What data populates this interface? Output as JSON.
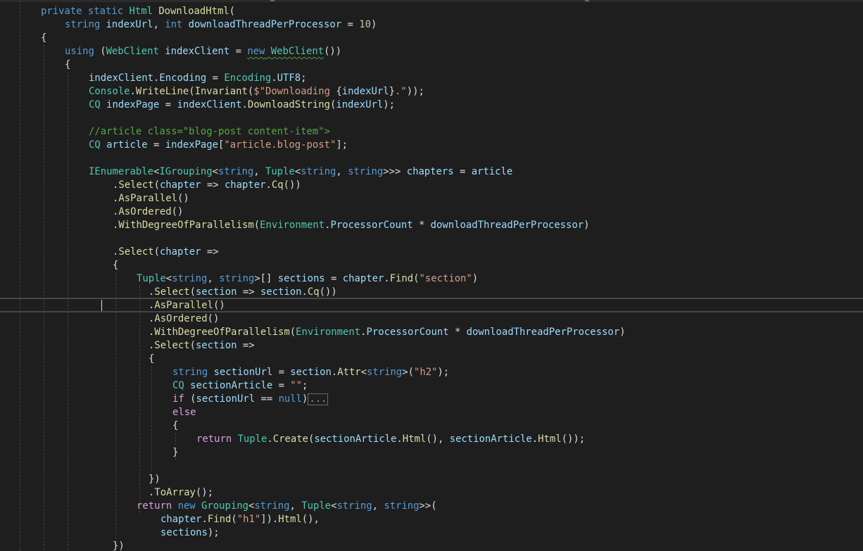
{
  "editor": {
    "language": "C#",
    "theme": "dark",
    "colors": {
      "background": "#1e1e1e",
      "keyword": "#569cd6",
      "control_keyword": "#d8a0df",
      "type": "#4ec9b0",
      "identifier": "#9cdcfe",
      "method": "#dcdcaa",
      "string": "#d69d85",
      "number": "#b5cea8",
      "comment": "#57a64a",
      "plain": "#dcdcdc"
    },
    "folded_region_label": "...",
    "caret_line": 22,
    "lines": [
      [
        [
          "kw",
          "private"
        ],
        [
          "pl",
          " "
        ],
        [
          "kw",
          "static"
        ],
        [
          "pl",
          " "
        ],
        [
          "type",
          "Html"
        ],
        [
          "pl",
          " "
        ],
        [
          "method",
          "DownloadHtml"
        ],
        [
          "pl",
          "("
        ]
      ],
      [
        [
          "kw",
          "string"
        ],
        [
          "pl",
          " "
        ],
        [
          "var",
          "indexUrl"
        ],
        [
          "pl",
          ", "
        ],
        [
          "kw",
          "int"
        ],
        [
          "pl",
          " "
        ],
        [
          "var",
          "downloadThreadPerProcessor"
        ],
        [
          "pl",
          " = "
        ],
        [
          "num",
          "10"
        ],
        [
          "pl",
          ")"
        ]
      ],
      [
        [
          "pl",
          "{"
        ]
      ],
      [
        [
          "kw",
          "using"
        ],
        [
          "pl",
          " ("
        ],
        [
          "type",
          "WebClient"
        ],
        [
          "pl",
          " "
        ],
        [
          "var",
          "indexClient"
        ],
        [
          "pl",
          " = "
        ],
        [
          "kw",
          "new"
        ],
        [
          "pl",
          " "
        ],
        [
          "type",
          "WebClient"
        ],
        [
          "pl",
          "())"
        ]
      ],
      [
        [
          "pl",
          "{"
        ]
      ],
      [
        [
          "var",
          "indexClient"
        ],
        [
          "pl",
          "."
        ],
        [
          "var",
          "Encoding"
        ],
        [
          "pl",
          " = "
        ],
        [
          "type",
          "Encoding"
        ],
        [
          "pl",
          "."
        ],
        [
          "var",
          "UTF8"
        ],
        [
          "pl",
          ";"
        ]
      ],
      [
        [
          "type",
          "Console"
        ],
        [
          "pl",
          "."
        ],
        [
          "method",
          "WriteLine"
        ],
        [
          "pl",
          "("
        ],
        [
          "method",
          "Invariant"
        ],
        [
          "pl",
          "("
        ],
        [
          "str",
          "$\"Downloading "
        ],
        [
          "pl",
          "{"
        ],
        [
          "var",
          "indexUrl"
        ],
        [
          "pl",
          "}"
        ],
        [
          "str",
          ".\""
        ],
        [
          "pl",
          "));"
        ]
      ],
      [
        [
          "type",
          "CQ"
        ],
        [
          "pl",
          " "
        ],
        [
          "var",
          "indexPage"
        ],
        [
          "pl",
          " = "
        ],
        [
          "var",
          "indexClient"
        ],
        [
          "pl",
          "."
        ],
        [
          "method",
          "DownloadString"
        ],
        [
          "pl",
          "("
        ],
        [
          "var",
          "indexUrl"
        ],
        [
          "pl",
          ");"
        ]
      ],
      [],
      [
        [
          "com",
          "//article class=\"blog-post content-item\">"
        ]
      ],
      [
        [
          "type",
          "CQ"
        ],
        [
          "pl",
          " "
        ],
        [
          "var",
          "article"
        ],
        [
          "pl",
          " = "
        ],
        [
          "var",
          "indexPage"
        ],
        [
          "pl",
          "["
        ],
        [
          "str",
          "\"article.blog-post\""
        ],
        [
          "pl",
          "];"
        ]
      ],
      [],
      [
        [
          "type",
          "IEnumerable"
        ],
        [
          "pl",
          "<"
        ],
        [
          "type",
          "IGrouping"
        ],
        [
          "pl",
          "<"
        ],
        [
          "kw",
          "string"
        ],
        [
          "pl",
          ", "
        ],
        [
          "type",
          "Tuple"
        ],
        [
          "pl",
          "<"
        ],
        [
          "kw",
          "string"
        ],
        [
          "pl",
          ", "
        ],
        [
          "kw",
          "string"
        ],
        [
          "pl",
          ">>> "
        ],
        [
          "var",
          "chapters"
        ],
        [
          "pl",
          " = "
        ],
        [
          "var",
          "article"
        ]
      ],
      [
        [
          "pl",
          "."
        ],
        [
          "method",
          "Select"
        ],
        [
          "pl",
          "("
        ],
        [
          "var",
          "chapter"
        ],
        [
          "pl",
          " => "
        ],
        [
          "var",
          "chapter"
        ],
        [
          "pl",
          "."
        ],
        [
          "method",
          "Cq"
        ],
        [
          "pl",
          "())"
        ]
      ],
      [
        [
          "pl",
          "."
        ],
        [
          "method",
          "AsParallel"
        ],
        [
          "pl",
          "()"
        ]
      ],
      [
        [
          "pl",
          "."
        ],
        [
          "method",
          "AsOrdered"
        ],
        [
          "pl",
          "()"
        ]
      ],
      [
        [
          "pl",
          "."
        ],
        [
          "method",
          "WithDegreeOfParallelism"
        ],
        [
          "pl",
          "("
        ],
        [
          "type",
          "Environment"
        ],
        [
          "pl",
          "."
        ],
        [
          "var",
          "ProcessorCount"
        ],
        [
          "pl",
          " * "
        ],
        [
          "var",
          "downloadThreadPerProcessor"
        ],
        [
          "pl",
          ")"
        ]
      ],
      [],
      [
        [
          "pl",
          "."
        ],
        [
          "method",
          "Select"
        ],
        [
          "pl",
          "("
        ],
        [
          "var",
          "chapter"
        ],
        [
          "pl",
          " =>"
        ]
      ],
      [
        [
          "pl",
          "{"
        ]
      ],
      [
        [
          "type",
          "Tuple"
        ],
        [
          "pl",
          "<"
        ],
        [
          "kw",
          "string"
        ],
        [
          "pl",
          ", "
        ],
        [
          "kw",
          "string"
        ],
        [
          "pl",
          ">[] "
        ],
        [
          "var",
          "sections"
        ],
        [
          "pl",
          " = "
        ],
        [
          "var",
          "chapter"
        ],
        [
          "pl",
          "."
        ],
        [
          "method",
          "Find"
        ],
        [
          "pl",
          "("
        ],
        [
          "str",
          "\"section\""
        ],
        [
          "pl",
          ")"
        ]
      ],
      [
        [
          "pl",
          "."
        ],
        [
          "method",
          "Select"
        ],
        [
          "pl",
          "("
        ],
        [
          "var",
          "section"
        ],
        [
          "pl",
          " => "
        ],
        [
          "var",
          "section"
        ],
        [
          "pl",
          "."
        ],
        [
          "method",
          "Cq"
        ],
        [
          "pl",
          "())"
        ]
      ],
      [
        [
          "pl",
          "."
        ],
        [
          "method",
          "AsParallel"
        ],
        [
          "pl",
          "()"
        ]
      ],
      [
        [
          "pl",
          "."
        ],
        [
          "method",
          "AsOrdered"
        ],
        [
          "pl",
          "()"
        ]
      ],
      [
        [
          "pl",
          "."
        ],
        [
          "method",
          "WithDegreeOfParallelism"
        ],
        [
          "pl",
          "("
        ],
        [
          "type",
          "Environment"
        ],
        [
          "pl",
          "."
        ],
        [
          "var",
          "ProcessorCount"
        ],
        [
          "pl",
          " * "
        ],
        [
          "var",
          "downloadThreadPerProcessor"
        ],
        [
          "pl",
          ")"
        ]
      ],
      [
        [
          "pl",
          "."
        ],
        [
          "method",
          "Select"
        ],
        [
          "pl",
          "("
        ],
        [
          "var",
          "section"
        ],
        [
          "pl",
          " =>"
        ]
      ],
      [
        [
          "pl",
          "{"
        ]
      ],
      [
        [
          "kw",
          "string"
        ],
        [
          "pl",
          " "
        ],
        [
          "var",
          "sectionUrl"
        ],
        [
          "pl",
          " = "
        ],
        [
          "var",
          "section"
        ],
        [
          "pl",
          "."
        ],
        [
          "method",
          "Attr"
        ],
        [
          "pl",
          "<"
        ],
        [
          "kw",
          "string"
        ],
        [
          "pl",
          ">("
        ],
        [
          "str",
          "\"h2\""
        ],
        [
          "pl",
          ");"
        ]
      ],
      [
        [
          "type",
          "CQ"
        ],
        [
          "pl",
          " "
        ],
        [
          "var",
          "sectionArticle"
        ],
        [
          "pl",
          " = "
        ],
        [
          "str",
          "\"\""
        ],
        [
          "pl",
          ";"
        ]
      ],
      [
        [
          "ctl",
          "if"
        ],
        [
          "pl",
          " ("
        ],
        [
          "var",
          "sectionUrl"
        ],
        [
          "pl",
          " == "
        ],
        [
          "kw",
          "null"
        ],
        [
          "pl",
          ")"
        ],
        [
          "fold",
          "..."
        ]
      ],
      [
        [
          "ctl",
          "else"
        ]
      ],
      [
        [
          "pl",
          "{"
        ]
      ],
      [
        [
          "ctl",
          "return"
        ],
        [
          "pl",
          " "
        ],
        [
          "type",
          "Tuple"
        ],
        [
          "pl",
          "."
        ],
        [
          "method",
          "Create"
        ],
        [
          "pl",
          "("
        ],
        [
          "var",
          "sectionArticle"
        ],
        [
          "pl",
          "."
        ],
        [
          "method",
          "Html"
        ],
        [
          "pl",
          "(), "
        ],
        [
          "var",
          "sectionArticle"
        ],
        [
          "pl",
          "."
        ],
        [
          "method",
          "Html"
        ],
        [
          "pl",
          "());"
        ]
      ],
      [
        [
          "pl",
          "}"
        ]
      ],
      [],
      [
        [
          "pl",
          "})"
        ]
      ],
      [
        [
          "pl",
          "."
        ],
        [
          "method",
          "ToArray"
        ],
        [
          "pl",
          "();"
        ]
      ],
      [
        [
          "ctl",
          "return"
        ],
        [
          "pl",
          " "
        ],
        [
          "kw",
          "new"
        ],
        [
          "pl",
          " "
        ],
        [
          "type",
          "Grouping"
        ],
        [
          "pl",
          "<"
        ],
        [
          "kw",
          "string"
        ],
        [
          "pl",
          ", "
        ],
        [
          "type",
          "Tuple"
        ],
        [
          "pl",
          "<"
        ],
        [
          "kw",
          "string"
        ],
        [
          "pl",
          ", "
        ],
        [
          "kw",
          "string"
        ],
        [
          "pl",
          ">>("
        ]
      ],
      [
        [
          "var",
          "chapter"
        ],
        [
          "pl",
          "."
        ],
        [
          "method",
          "Find"
        ],
        [
          "pl",
          "("
        ],
        [
          "str",
          "\"h1\""
        ],
        [
          "pl",
          "])."
        ],
        [
          "method",
          "Html"
        ],
        [
          "pl",
          "(),"
        ]
      ],
      [
        [
          "var",
          "sections"
        ],
        [
          "pl",
          ");"
        ]
      ],
      [
        [
          "pl",
          "})"
        ]
      ]
    ]
  }
}
